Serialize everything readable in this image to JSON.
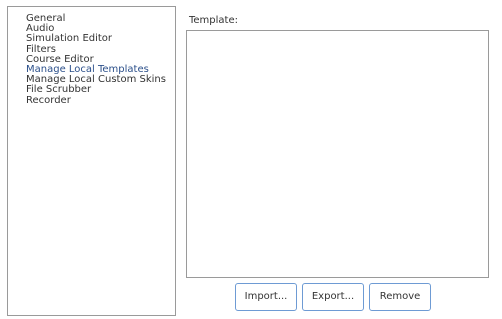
{
  "categories": {
    "items": [
      {
        "label": "General"
      },
      {
        "label": "Audio"
      },
      {
        "label": "Simulation Editor"
      },
      {
        "label": "Filters"
      },
      {
        "label": "Course Editor"
      },
      {
        "label": "Manage Local Templates"
      },
      {
        "label": "Manage Local Custom Skins"
      },
      {
        "label": "File Scrubber"
      },
      {
        "label": "Recorder"
      }
    ],
    "selected": "Manage Local Templates"
  },
  "template": {
    "label": "Template:",
    "items": []
  },
  "buttons": {
    "import_label": "Import...",
    "export_label": "Export...",
    "remove_label": "Remove"
  },
  "colors": {
    "selected_text": "#2b4f8a",
    "button_border": "#6e9bd4"
  }
}
